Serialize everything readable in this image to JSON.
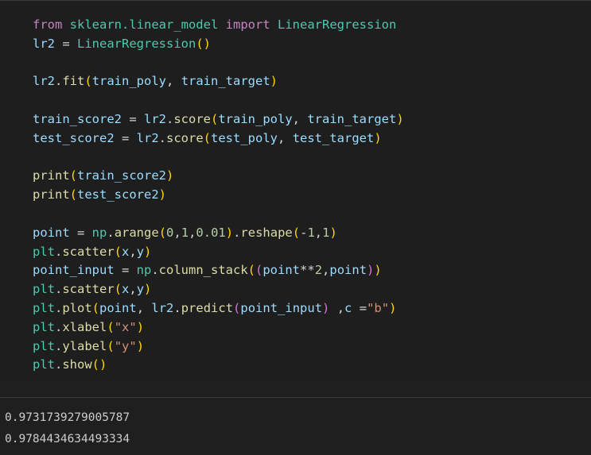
{
  "code_cell": {
    "lines": [
      [
        [
          "kw",
          "from"
        ],
        [
          "op",
          " "
        ],
        [
          "mod",
          "sklearn.linear_model"
        ],
        [
          "op",
          " "
        ],
        [
          "kw",
          "import"
        ],
        [
          "op",
          " "
        ],
        [
          "cls",
          "LinearRegression"
        ]
      ],
      [
        [
          "var",
          "lr2"
        ],
        [
          "op",
          " = "
        ],
        [
          "cls",
          "LinearRegression"
        ],
        [
          "p1",
          "()"
        ]
      ],
      [],
      [
        [
          "var",
          "lr2"
        ],
        [
          "op",
          "."
        ],
        [
          "fn",
          "fit"
        ],
        [
          "p1",
          "("
        ],
        [
          "var",
          "train_poly"
        ],
        [
          "op",
          ", "
        ],
        [
          "var",
          "train_target"
        ],
        [
          "p1",
          ")"
        ]
      ],
      [],
      [
        [
          "var",
          "train_score2"
        ],
        [
          "op",
          " = "
        ],
        [
          "var",
          "lr2"
        ],
        [
          "op",
          "."
        ],
        [
          "fn",
          "score"
        ],
        [
          "p1",
          "("
        ],
        [
          "var",
          "train_poly"
        ],
        [
          "op",
          ", "
        ],
        [
          "var",
          "train_target"
        ],
        [
          "p1",
          ")"
        ]
      ],
      [
        [
          "var",
          "test_score2"
        ],
        [
          "op",
          " = "
        ],
        [
          "var",
          "lr2"
        ],
        [
          "op",
          "."
        ],
        [
          "fn",
          "score"
        ],
        [
          "p1",
          "("
        ],
        [
          "var",
          "test_poly"
        ],
        [
          "op",
          ", "
        ],
        [
          "var",
          "test_target"
        ],
        [
          "p1",
          ")"
        ]
      ],
      [],
      [
        [
          "fn",
          "print"
        ],
        [
          "p1",
          "("
        ],
        [
          "var",
          "train_score2"
        ],
        [
          "p1",
          ")"
        ]
      ],
      [
        [
          "fn",
          "print"
        ],
        [
          "p1",
          "("
        ],
        [
          "var",
          "test_score2"
        ],
        [
          "p1",
          ")"
        ]
      ],
      [],
      [
        [
          "var",
          "point"
        ],
        [
          "op",
          " = "
        ],
        [
          "mod",
          "np"
        ],
        [
          "op",
          "."
        ],
        [
          "fn",
          "arange"
        ],
        [
          "p1",
          "("
        ],
        [
          "num",
          "0"
        ],
        [
          "op",
          ","
        ],
        [
          "num",
          "1"
        ],
        [
          "op",
          ","
        ],
        [
          "num",
          "0.01"
        ],
        [
          "p1",
          ")"
        ],
        [
          "op",
          "."
        ],
        [
          "fn",
          "reshape"
        ],
        [
          "p1",
          "("
        ],
        [
          "op",
          "-"
        ],
        [
          "num",
          "1"
        ],
        [
          "op",
          ","
        ],
        [
          "num",
          "1"
        ],
        [
          "p1",
          ")"
        ]
      ],
      [
        [
          "mod",
          "plt"
        ],
        [
          "op",
          "."
        ],
        [
          "fn",
          "scatter"
        ],
        [
          "p1",
          "("
        ],
        [
          "var",
          "x"
        ],
        [
          "op",
          ","
        ],
        [
          "var",
          "y"
        ],
        [
          "p1",
          ")"
        ]
      ],
      [
        [
          "var",
          "point_input"
        ],
        [
          "op",
          " = "
        ],
        [
          "mod",
          "np"
        ],
        [
          "op",
          "."
        ],
        [
          "fn",
          "column_stack"
        ],
        [
          "p1",
          "("
        ],
        [
          "p2",
          "("
        ],
        [
          "var",
          "point"
        ],
        [
          "op",
          "**"
        ],
        [
          "num",
          "2"
        ],
        [
          "op",
          ","
        ],
        [
          "var",
          "point"
        ],
        [
          "p2",
          ")"
        ],
        [
          "p1",
          ")"
        ]
      ],
      [
        [
          "mod",
          "plt"
        ],
        [
          "op",
          "."
        ],
        [
          "fn",
          "scatter"
        ],
        [
          "p1",
          "("
        ],
        [
          "var",
          "x"
        ],
        [
          "op",
          ","
        ],
        [
          "var",
          "y"
        ],
        [
          "p1",
          ")"
        ]
      ],
      [
        [
          "mod",
          "plt"
        ],
        [
          "op",
          "."
        ],
        [
          "fn",
          "plot"
        ],
        [
          "p1",
          "("
        ],
        [
          "var",
          "point"
        ],
        [
          "op",
          ", "
        ],
        [
          "var",
          "lr2"
        ],
        [
          "op",
          "."
        ],
        [
          "fn",
          "predict"
        ],
        [
          "p2",
          "("
        ],
        [
          "var",
          "point_input"
        ],
        [
          "p2",
          ")"
        ],
        [
          "op",
          " ,"
        ],
        [
          "var",
          "c"
        ],
        [
          "op",
          " ="
        ],
        [
          "str",
          "\"b\""
        ],
        [
          "p1",
          ")"
        ]
      ],
      [
        [
          "mod",
          "plt"
        ],
        [
          "op",
          "."
        ],
        [
          "fn",
          "xlabel"
        ],
        [
          "p1",
          "("
        ],
        [
          "str",
          "\"x\""
        ],
        [
          "p1",
          ")"
        ]
      ],
      [
        [
          "mod",
          "plt"
        ],
        [
          "op",
          "."
        ],
        [
          "fn",
          "ylabel"
        ],
        [
          "p1",
          "("
        ],
        [
          "str",
          "\"y\""
        ],
        [
          "p1",
          ")"
        ]
      ],
      [
        [
          "mod",
          "plt"
        ],
        [
          "op",
          "."
        ],
        [
          "fn",
          "show"
        ],
        [
          "p1",
          "()"
        ]
      ]
    ]
  },
  "output": {
    "lines": [
      "0.9731739279005787",
      "0.9784434634493334"
    ]
  },
  "colors": {
    "background": "#1f1f1f",
    "editor_background": "#1e1e1e",
    "keyword": "#c586c0",
    "class": "#4ec9b0",
    "function": "#dcdcaa",
    "variable": "#9cdcfe",
    "number": "#b5cea8",
    "string": "#ce9178",
    "bracket_1": "#ffd700",
    "bracket_2": "#da70d6",
    "output_text": "#cccccc"
  }
}
